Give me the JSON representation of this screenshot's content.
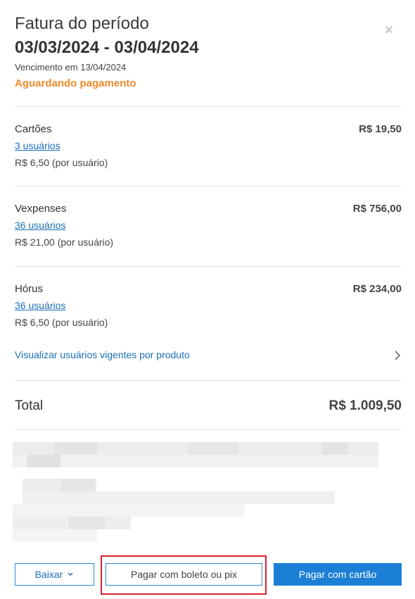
{
  "header": {
    "title": "Fatura do período",
    "period": "03/03/2024 - 03/04/2024",
    "due": "Vencimento em 13/04/2024",
    "status": "Aguardando pagamento",
    "close_symbol": "×"
  },
  "products": [
    {
      "name": "Cartões",
      "price": "R$ 19,50",
      "users": "3 usuários",
      "unit": "R$ 6,50 (por usuário)"
    },
    {
      "name": "Vexpenses",
      "price": "R$ 756,00",
      "users": "36 usuários",
      "unit": "R$ 21,00 (por usuário)"
    },
    {
      "name": "Hórus",
      "price": "R$ 234,00",
      "users": "36 usuários",
      "unit": "R$ 6,50 (por usuário)"
    }
  ],
  "view_link": "Visualizar usuários vigentes por produto",
  "total": {
    "label": "Total",
    "value": "R$ 1.009,50"
  },
  "buttons": {
    "download": "Baixar",
    "boleto": "Pagar com boleto ou pix",
    "card": "Pagar com cartão"
  },
  "colors": {
    "accent": "#1b7fd6",
    "link": "#1b6fb8",
    "status": "#f0892c",
    "highlight": "#d9232e"
  },
  "icons": {
    "close": "close-icon",
    "chevron": "chevron-right-icon",
    "caret": "chevron-down-icon"
  }
}
